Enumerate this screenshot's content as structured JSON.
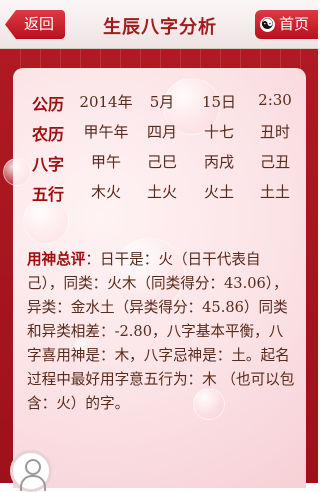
{
  "header": {
    "back_label": "返回",
    "title": "生辰八字分析",
    "home_label": "首页",
    "home_icon": "yin-yang-icon"
  },
  "bazi": {
    "rows": [
      {
        "label": "公历",
        "cells": [
          "2014年",
          "5月",
          "15日",
          "2:30"
        ]
      },
      {
        "label": "农历",
        "cells": [
          "甲午年",
          "四月",
          "十七",
          "丑时"
        ]
      },
      {
        "label": "八字",
        "cells": [
          "甲午",
          "己巳",
          "丙戌",
          "己丑"
        ]
      },
      {
        "label": "五行",
        "cells": [
          "木火",
          "土火",
          "火土",
          "土土"
        ]
      }
    ]
  },
  "analysis": {
    "lead": "用神总评",
    "text": "：日干是：火（日干代表自己），同类：火木（同类得分：43.06），异类：金水土（异类得分：45.86）同类和异类相差：-2.80，八字基本平衡，八字喜用神是：木，八字忌神是：土。起名过程中最好用字意五行为：木 （也可以包含：火）的字。"
  },
  "colors": {
    "brand_red": "#b01a22",
    "heading_red": "#a00e10",
    "text_brown": "#5a2a1a"
  },
  "icons": {
    "avatar": "user-avatar-icon"
  }
}
